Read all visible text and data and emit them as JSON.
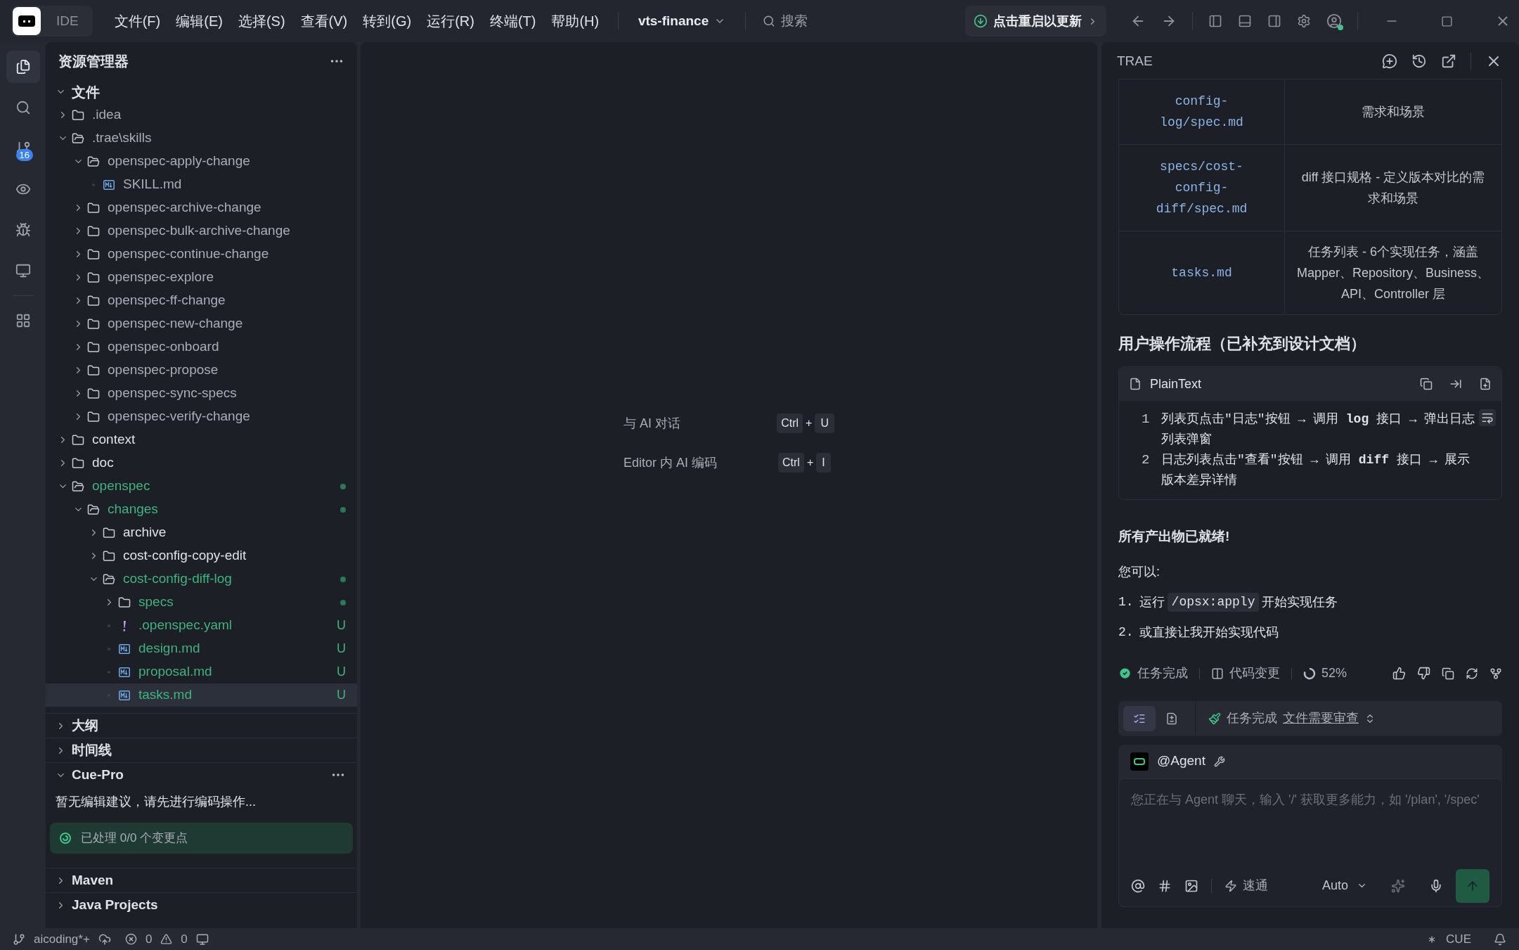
{
  "window": {
    "logo_label": "IDE",
    "menus": [
      "文件(F)",
      "编辑(E)",
      "选择(S)",
      "查看(V)",
      "转到(G)",
      "运行(R)",
      "终端(T)",
      "帮助(H)"
    ],
    "project": "vts-finance",
    "search": {
      "placeholder": "搜索"
    },
    "update_button": "点击重启以更新"
  },
  "activity_bar": {
    "items": [
      {
        "kind": "explorer",
        "selected": true
      },
      {
        "kind": "search",
        "selected": false
      },
      {
        "kind": "source-control",
        "selected": false,
        "badge": "16"
      },
      {
        "kind": "preview",
        "selected": false
      },
      {
        "kind": "debug",
        "selected": false
      },
      {
        "kind": "remote",
        "selected": false
      },
      {
        "kind": "extensions",
        "selected": false
      }
    ]
  },
  "explorer": {
    "title": "资源管理器",
    "root": {
      "label": "文件",
      "expanded": true
    },
    "tree": [
      {
        "label": ".idea",
        "kind": "folder",
        "expanded": false,
        "changed": false,
        "dot": false,
        "dimmed": true,
        "selected": false
      },
      {
        "label": ".trae\\skills",
        "kind": "folder",
        "expanded": true,
        "changed": false,
        "dot": false,
        "dimmed": true,
        "selected": false,
        "children": [
          {
            "label": "openspec-apply-change",
            "kind": "folder",
            "expanded": true,
            "changed": false,
            "dot": false,
            "dimmed": true,
            "selected": false,
            "children": [
              {
                "label": "SKILL.md",
                "kind": "markdown",
                "changed": false,
                "dot": false,
                "dimmed": true,
                "selected": false
              }
            ]
          },
          {
            "label": "openspec-archive-change",
            "kind": "folder",
            "expanded": false,
            "changed": false,
            "dot": false,
            "dimmed": true,
            "selected": false
          },
          {
            "label": "openspec-bulk-archive-change",
            "kind": "folder",
            "expanded": false,
            "changed": false,
            "dot": false,
            "dimmed": true,
            "selected": false
          },
          {
            "label": "openspec-continue-change",
            "kind": "folder",
            "expanded": false,
            "changed": false,
            "dot": false,
            "dimmed": true,
            "selected": false
          },
          {
            "label": "openspec-explore",
            "kind": "folder",
            "expanded": false,
            "changed": false,
            "dot": false,
            "dimmed": true,
            "selected": false
          },
          {
            "label": "openspec-ff-change",
            "kind": "folder",
            "expanded": false,
            "changed": false,
            "dot": false,
            "dimmed": true,
            "selected": false
          },
          {
            "label": "openspec-new-change",
            "kind": "folder",
            "expanded": false,
            "changed": false,
            "dot": false,
            "dimmed": true,
            "selected": false
          },
          {
            "label": "openspec-onboard",
            "kind": "folder",
            "expanded": false,
            "changed": false,
            "dot": false,
            "dimmed": true,
            "selected": false
          },
          {
            "label": "openspec-propose",
            "kind": "folder",
            "expanded": false,
            "changed": false,
            "dot": false,
            "dimmed": true,
            "selected": false
          },
          {
            "label": "openspec-sync-specs",
            "kind": "folder",
            "expanded": false,
            "changed": false,
            "dot": false,
            "dimmed": true,
            "selected": false
          },
          {
            "label": "openspec-verify-change",
            "kind": "folder",
            "expanded": false,
            "changed": false,
            "dot": false,
            "dimmed": true,
            "selected": false
          }
        ]
      },
      {
        "label": "context",
        "kind": "folder",
        "expanded": false,
        "changed": false,
        "dot": false,
        "dimmed": false,
        "selected": false
      },
      {
        "label": "doc",
        "kind": "folder",
        "expanded": false,
        "changed": false,
        "dot": false,
        "dimmed": false,
        "selected": false
      },
      {
        "label": "openspec",
        "kind": "folder",
        "expanded": true,
        "changed": true,
        "dot": true,
        "dimmed": false,
        "selected": false,
        "children": [
          {
            "label": "changes",
            "kind": "folder",
            "expanded": true,
            "changed": true,
            "dot": true,
            "dimmed": false,
            "selected": false,
            "children": [
              {
                "label": "archive",
                "kind": "folder",
                "expanded": false,
                "changed": false,
                "dot": false,
                "dimmed": false,
                "selected": false
              },
              {
                "label": "cost-config-copy-edit",
                "kind": "folder",
                "expanded": false,
                "changed": false,
                "dot": false,
                "dimmed": false,
                "selected": false
              },
              {
                "label": "cost-config-diff-log",
                "kind": "folder",
                "expanded": true,
                "changed": true,
                "dot": true,
                "dimmed": false,
                "selected": false,
                "children": [
                  {
                    "label": "specs",
                    "kind": "folder",
                    "expanded": false,
                    "changed": true,
                    "dot": true,
                    "dimmed": false,
                    "selected": false
                  },
                  {
                    "label": ".openspec.yaml",
                    "kind": "yaml",
                    "changed": true,
                    "dot": false,
                    "badge": "U",
                    "dimmed": false,
                    "selected": false
                  },
                  {
                    "label": "design.md",
                    "kind": "markdown",
                    "changed": true,
                    "dot": false,
                    "badge": "U",
                    "dimmed": false,
                    "selected": false
                  },
                  {
                    "label": "proposal.md",
                    "kind": "markdown",
                    "changed": true,
                    "dot": false,
                    "badge": "U",
                    "dimmed": false,
                    "selected": false
                  },
                  {
                    "label": "tasks.md",
                    "kind": "markdown",
                    "changed": true,
                    "dot": false,
                    "badge": "U",
                    "dimmed": false,
                    "selected": true
                  }
                ]
              }
            ]
          }
        ]
      }
    ],
    "sections": [
      {
        "label": "大纲",
        "expanded": false
      },
      {
        "label": "时间线",
        "expanded": false
      },
      {
        "label": "Cue-Pro",
        "expanded": true,
        "message": "暂无编辑建议，请先进行编码操作...",
        "progress": "已处理 0/0 个变更点"
      },
      {
        "label": "Maven",
        "expanded": false
      },
      {
        "label": "Java Projects",
        "expanded": false
      }
    ]
  },
  "editor": {
    "shortcuts": [
      {
        "label": "与 AI 对话",
        "keys": [
          "Ctrl",
          "U"
        ]
      },
      {
        "label": "Editor 内 AI 编码",
        "keys": [
          "Ctrl",
          "I"
        ]
      }
    ],
    "joiner": "+"
  },
  "assistant": {
    "title": "TRAE",
    "table": {
      "rows": [
        {
          "file": "config-\nlog/spec.md",
          "description": "需求和场景"
        },
        {
          "file": "specs/cost-\nconfig-\ndiff/spec.md",
          "description": "diff 接口规格 - 定义版本对比的需求和场景"
        },
        {
          "file": "tasks.md",
          "description": "任务列表 - 6个实现任务，涵盖 Mapper、Repository、Business、API、Controller 层"
        }
      ]
    },
    "heading": "用户操作流程（已补充到设计文档）",
    "code_block": {
      "language": "PlainText",
      "lines": [
        {
          "number": "1",
          "text": "列表页点击\"日志\"按钮 → 调用 **log** 接口 → 弹出日志列表弹窗"
        },
        {
          "number": "2",
          "text": "日志列表点击\"查看\"按钮 → 调用 **diff** 接口 → 展示版本差异详情"
        }
      ]
    },
    "summary": {
      "title": "所有产出物已就绪!",
      "intro": "您可以:",
      "steps": [
        {
          "number": "1.",
          "before": "运行 ",
          "code": "/opsx:apply",
          "after": " 开始实现任务"
        },
        {
          "number": "2.",
          "before": "或直接让我开始实现代码"
        }
      ]
    },
    "result_row": {
      "done": "任务完成",
      "changes": "代码变更",
      "progress": "52%"
    },
    "mode_bar": {
      "tabs": [
        {
          "kind": "list",
          "selected": true
        },
        {
          "kind": "document",
          "selected": false
        }
      ],
      "status": "任务完成",
      "link": "文件需要审查"
    },
    "chat_input": {
      "agent": "@Agent",
      "placeholder": "您正在与 Agent 聊天，输入 '/' 获取更多能力，如 '/plan', '/spec'",
      "mode": "速通",
      "model": "Auto"
    }
  },
  "status_bar": {
    "branch": "aicoding*+",
    "errors": "0",
    "warnings": "0",
    "cue": "CUE"
  }
}
